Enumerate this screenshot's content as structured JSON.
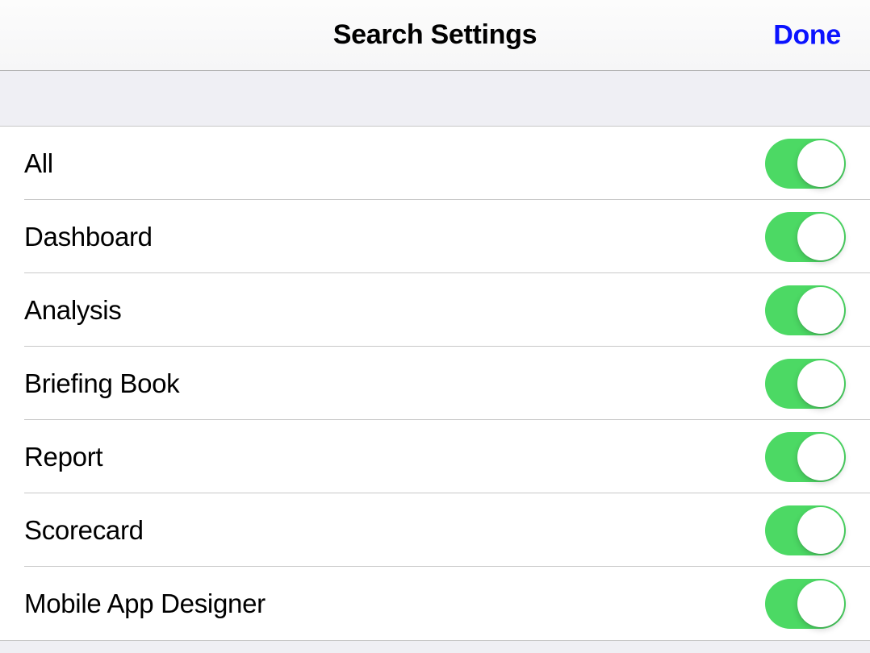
{
  "navbar": {
    "title": "Search Settings",
    "done_label": "Done"
  },
  "settings": [
    {
      "label": "All",
      "on": true
    },
    {
      "label": "Dashboard",
      "on": true
    },
    {
      "label": "Analysis",
      "on": true
    },
    {
      "label": "Briefing Book",
      "on": true
    },
    {
      "label": "Report",
      "on": true
    },
    {
      "label": "Scorecard",
      "on": true
    },
    {
      "label": "Mobile App Designer",
      "on": true
    }
  ]
}
